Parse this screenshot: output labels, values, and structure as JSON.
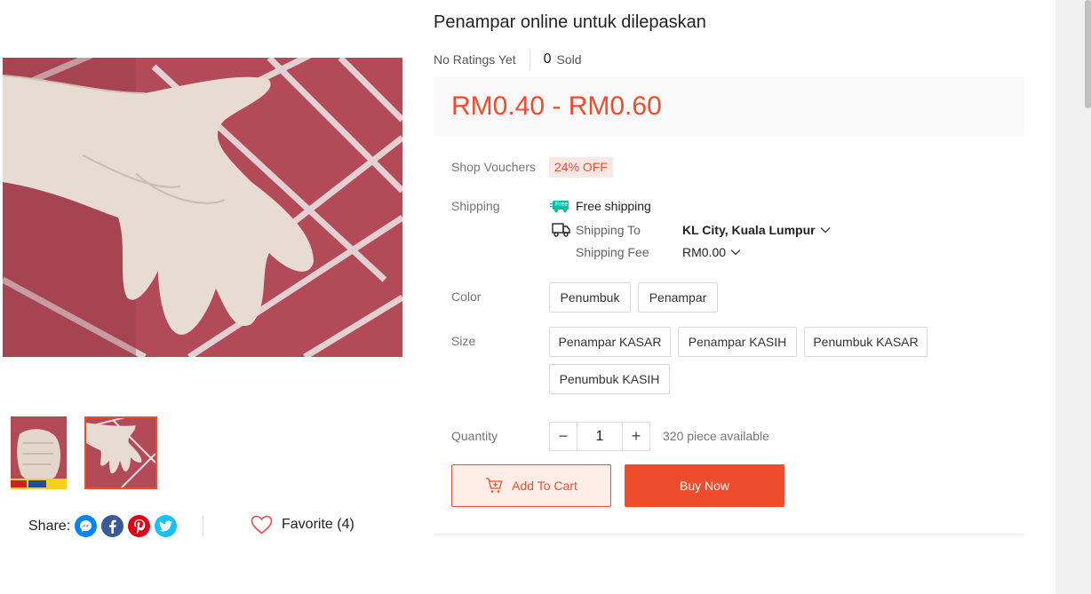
{
  "product": {
    "title": "Penampar online untuk dilepaskan",
    "ratings_text": "No Ratings Yet",
    "sold_count": "0",
    "sold_label": "Sold",
    "price": "RM0.40 - RM0.60"
  },
  "vouchers": {
    "label": "Shop Vouchers",
    "badge": "24% OFF"
  },
  "shipping": {
    "label": "Shipping",
    "free_badge": "Free",
    "free_text": "Free shipping",
    "to_label": "Shipping To",
    "to_value": "KL City, Kuala Lumpur",
    "fee_label": "Shipping Fee",
    "fee_value": "RM0.00"
  },
  "color": {
    "label": "Color",
    "options": [
      "Penumbuk",
      "Penampar"
    ]
  },
  "size": {
    "label": "Size",
    "options": [
      "Penampar KASAR",
      "Penampar KASIH",
      "Penumbuk KASAR",
      "Penumbuk KASIH"
    ]
  },
  "quantity": {
    "label": "Quantity",
    "value": "1",
    "minus": "−",
    "plus": "+",
    "available": "320 piece available"
  },
  "actions": {
    "add_to_cart": "Add To Cart",
    "buy_now": "Buy Now"
  },
  "share": {
    "label": "Share:",
    "favorite": "Favorite (4)"
  },
  "colors": {
    "accent": "#ee4d2d",
    "messenger": "#0084ff",
    "facebook": "#3b5999",
    "pinterest": "#de0217",
    "twitter": "#10c2ff"
  }
}
